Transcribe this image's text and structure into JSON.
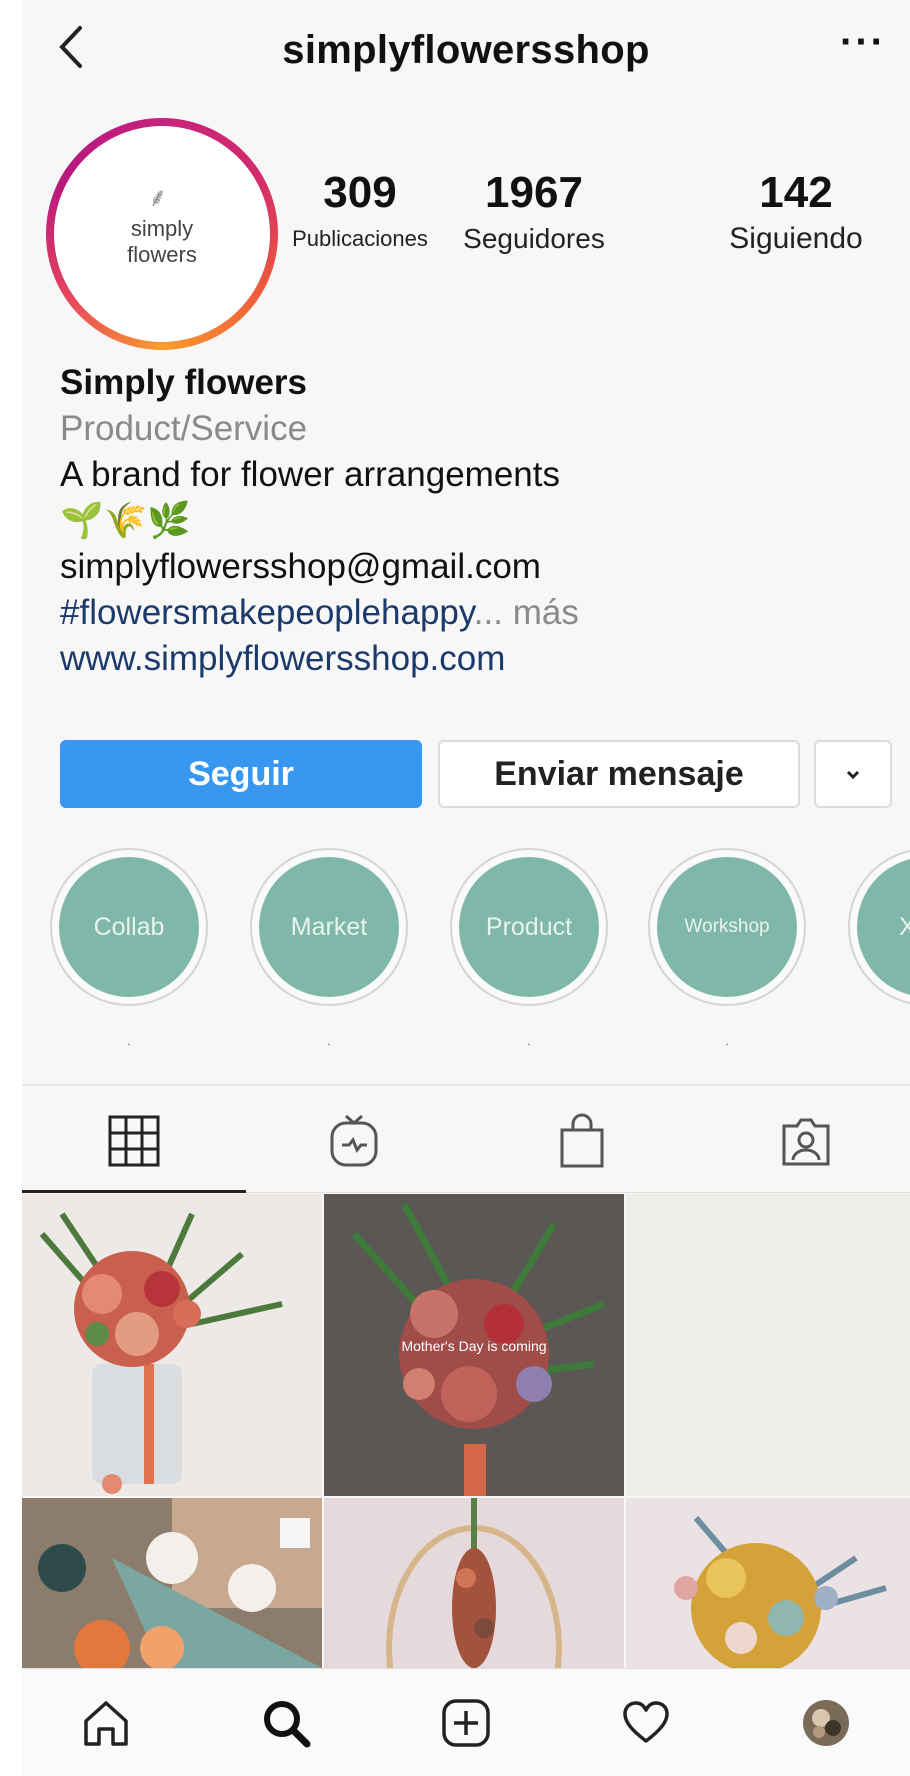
{
  "header": {
    "title": "simplyflowersshop",
    "back_icon": "chevron-left-icon",
    "more_label": "···"
  },
  "profile": {
    "avatar_logo_line1": "simply",
    "avatar_logo_line2": "flowers",
    "stats": [
      {
        "value": "309",
        "label": "Publicaciones"
      },
      {
        "value": "1967",
        "label": "Seguidores"
      },
      {
        "value": "142",
        "label": "Siguiendo"
      }
    ]
  },
  "bio": {
    "name": "Simply flowers",
    "category": "Product/Service",
    "description": "A brand for flower arrangements",
    "emoji": "🌱🌾🌿",
    "email": "simplyflowersshop@gmail.com",
    "hashtag": "#flowersmakepeoplehappy",
    "more_ellipsis": "...",
    "more_label": "más",
    "website": "www.simplyflowersshop.com"
  },
  "actions": {
    "follow_label": "Seguir",
    "message_label": "Enviar mensaje",
    "dropdown_icon": "chevron-down-icon"
  },
  "highlights": [
    {
      "label": "Collab",
      "caption": "."
    },
    {
      "label": "Market",
      "caption": "."
    },
    {
      "label": "Product",
      "caption": "."
    },
    {
      "label": "Workshop",
      "caption": "."
    },
    {
      "label": "Xi",
      "caption": ""
    }
  ],
  "tabs": [
    {
      "name": "grid",
      "icon": "grid-icon",
      "active": true
    },
    {
      "name": "igtv",
      "icon": "igtv-icon",
      "active": false
    },
    {
      "name": "shop",
      "icon": "shopping-bag-icon",
      "active": false
    },
    {
      "name": "tagged",
      "icon": "tagged-user-icon",
      "active": false
    }
  ],
  "posts": [
    {
      "alt": "bouquet in jar",
      "overlay": ""
    },
    {
      "alt": "bouquet",
      "overlay": "Mother's Day is coming"
    },
    {
      "alt": "empty",
      "overlay": ""
    },
    {
      "alt": "cotton and dried flowers",
      "overlay": ""
    },
    {
      "alt": "hanging dried flower hoop",
      "overlay": ""
    },
    {
      "alt": "yellow and blue bouquet",
      "overlay": ""
    }
  ],
  "bottom_nav": [
    "home-icon",
    "search-icon",
    "add-post-icon",
    "heart-icon",
    "profile-avatar"
  ],
  "colors": {
    "follow": "#3897f0",
    "highlight": "#7fb8a8",
    "link": "#1b3a6b"
  }
}
